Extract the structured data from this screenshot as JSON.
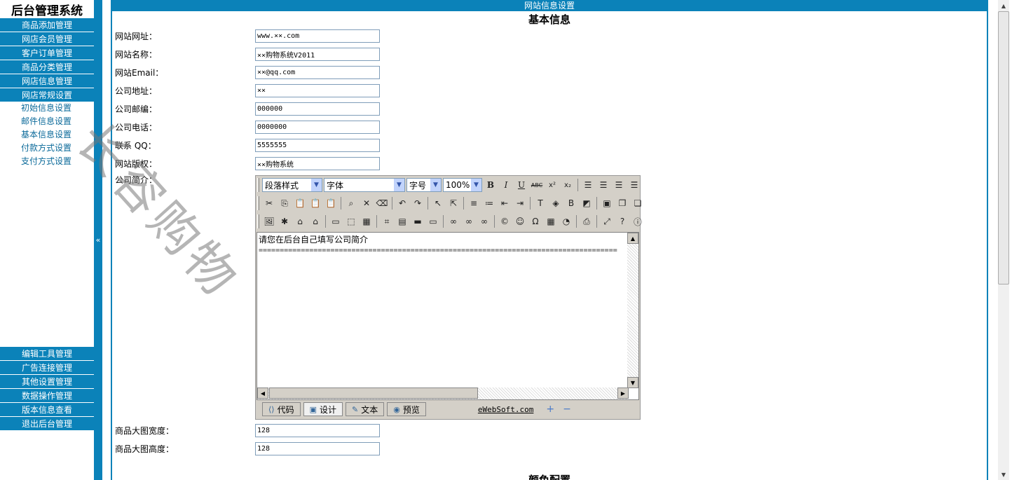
{
  "app": {
    "title": "后台管理系统"
  },
  "sidebar": {
    "top_menu": [
      {
        "label": "商品添加管理"
      },
      {
        "label": "网店会员管理"
      },
      {
        "label": "客户订单管理"
      },
      {
        "label": "商品分类管理"
      },
      {
        "label": "网店信息管理"
      },
      {
        "label": "网店常规设置"
      }
    ],
    "sub_menu": [
      {
        "label": "初始信息设置"
      },
      {
        "label": "邮件信息设置"
      },
      {
        "label": "基本信息设置"
      },
      {
        "label": "付款方式设置"
      },
      {
        "label": "支付方式设置"
      }
    ],
    "bottom_menu": [
      {
        "label": "编辑工具管理"
      },
      {
        "label": "广告连接管理"
      },
      {
        "label": "其他设置管理"
      },
      {
        "label": "数据操作管理"
      },
      {
        "label": "版本信息查看"
      },
      {
        "label": "退出后台管理"
      }
    ]
  },
  "splitter": {
    "icon": "«"
  },
  "main": {
    "header": "网站信息设置",
    "section_title": "基本信息",
    "fields": [
      {
        "label": "网站网址：",
        "value": "www.××.com"
      },
      {
        "label": "网站名称：",
        "value": "××购物系统V2011"
      },
      {
        "label": "网站Email：",
        "value": "××@qq.com"
      },
      {
        "label": "公司地址：",
        "value": "××"
      },
      {
        "label": "公司邮编：",
        "value": "000000"
      },
      {
        "label": "公司电话：",
        "value": "0000000"
      },
      {
        "label": "联系 QQ：",
        "value": "5555555"
      },
      {
        "label": "网站版权：",
        "value": "××购物系统"
      }
    ],
    "intro_label": "公司简介：",
    "editor": {
      "paragraph_style": "段落样式",
      "font": "字体",
      "font_size": "字号",
      "zoom": "100%",
      "content": "请您在后台自己填写公司简介",
      "divider": "=====================================================================================",
      "tabs": [
        {
          "label": "代码",
          "icon": "code-icon"
        },
        {
          "label": "设计",
          "icon": "design-icon"
        },
        {
          "label": "文本",
          "icon": "text-icon"
        },
        {
          "label": "预览",
          "icon": "preview-icon"
        }
      ],
      "active_tab": "设计",
      "brand": "eWebSoft.com",
      "zoom_in": "+",
      "zoom_out": "−"
    },
    "image_fields": [
      {
        "label": "商品大图宽度：",
        "value": "128"
      },
      {
        "label": "商品大图高度：",
        "value": "128"
      }
    ],
    "section2_title": "颜色配置"
  },
  "watermark": {
    "text": "长容购物"
  }
}
